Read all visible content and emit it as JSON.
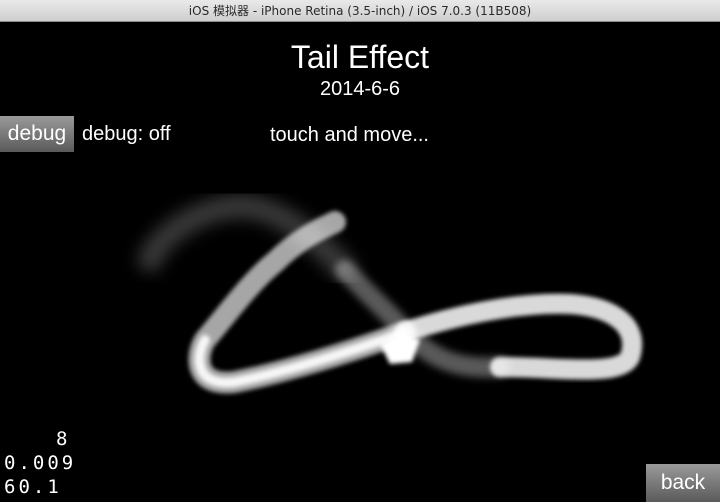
{
  "window": {
    "title": "iOS 模拟器 - iPhone Retina (3.5-inch) / iOS 7.0.3 (11B508)"
  },
  "scene": {
    "title": "Tail Effect",
    "date": "2014-6-6",
    "hint": "touch and move..."
  },
  "debug": {
    "button_label": "debug",
    "status": "debug: off"
  },
  "stats": {
    "line1": "8",
    "line2": "0.009",
    "line3": "60.1"
  },
  "nav": {
    "back_label": "back"
  },
  "colors": {
    "trail": "#ffffff",
    "background": "#000000"
  }
}
